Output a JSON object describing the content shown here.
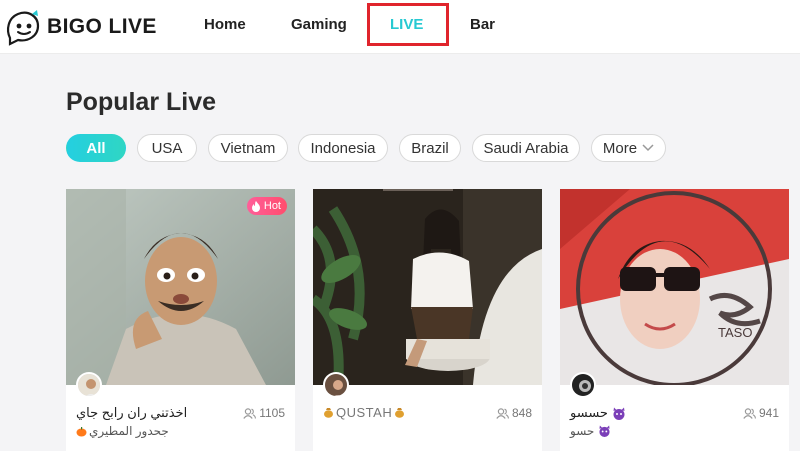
{
  "brand": {
    "logo_text": "BIGO LIVE"
  },
  "nav": {
    "home": "Home",
    "gaming": "Gaming",
    "live": "LIVE",
    "bar": "Bar"
  },
  "section": {
    "title": "Popular Live"
  },
  "filters": {
    "all": "All",
    "usa": "USA",
    "vietnam": "Vietnam",
    "indonesia": "Indonesia",
    "brazil": "Brazil",
    "saudi": "Saudi Arabia",
    "more": "More"
  },
  "cards": [
    {
      "title": "اخذتني ران رابح جاي",
      "subtitle": "جحدور المطيري",
      "viewers": "1105",
      "badge": "Hot"
    },
    {
      "title": "QUSTAH",
      "subtitle": "",
      "viewers": "848",
      "badge": ""
    },
    {
      "title": "حسسو",
      "subtitle": "حسو",
      "viewers": "941",
      "badge": ""
    }
  ],
  "colors": {
    "accent": "#27c9d2",
    "highlight": "#e0242c",
    "hot": "#ff4d6d"
  }
}
